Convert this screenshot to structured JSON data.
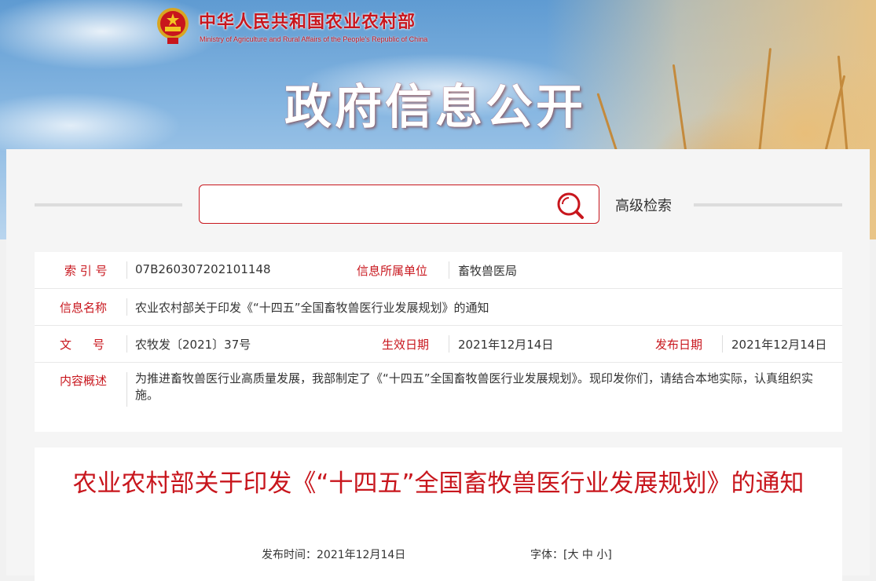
{
  "header": {
    "site_title": "中华人民共和国农业农村部",
    "site_subtitle": "Ministry of Agriculture and Rural Affairs of the People's Republic of China",
    "section_title": "政府信息公开"
  },
  "search": {
    "value": "",
    "placeholder": "",
    "advanced_label": "高级检索"
  },
  "info": {
    "index_label": "索 引 号",
    "index_value": "07B260307202101148",
    "unit_label": "信息所属单位",
    "unit_value": "畜牧兽医局",
    "name_label": "信息名称",
    "name_value": "农业农村部关于印发《“十四五”全国畜牧兽医行业发展规划》的通知",
    "doc_label": "文　号",
    "doc_value": "农牧发〔2021〕37号",
    "effective_label": "生效日期",
    "effective_value": "2021年12月14日",
    "publish_label": "发布日期",
    "publish_value": "2021年12月14日",
    "summary_label": "内容概述",
    "summary_value": "为推进畜牧兽医行业高质量发展，我部制定了《“十四五”全国畜牧兽医行业发展规划》。现印发你们，请结合本地实际，认真组织实施。"
  },
  "article": {
    "title": "农业农村部关于印发《“十四五”全国畜牧兽医行业发展规划》的通知",
    "publish_time_label": "发布时间：",
    "publish_time_value": "2021年12月14日",
    "font_label": "字体：",
    "font_open": "[",
    "font_large": "大",
    "font_medium": "中",
    "font_small": "小",
    "font_close": "]"
  },
  "colors": {
    "accent": "#c8161d",
    "text": "#333333",
    "background": "#f5f5f5"
  },
  "icons": {
    "search": "search-icon",
    "emblem": "national-emblem-icon"
  }
}
